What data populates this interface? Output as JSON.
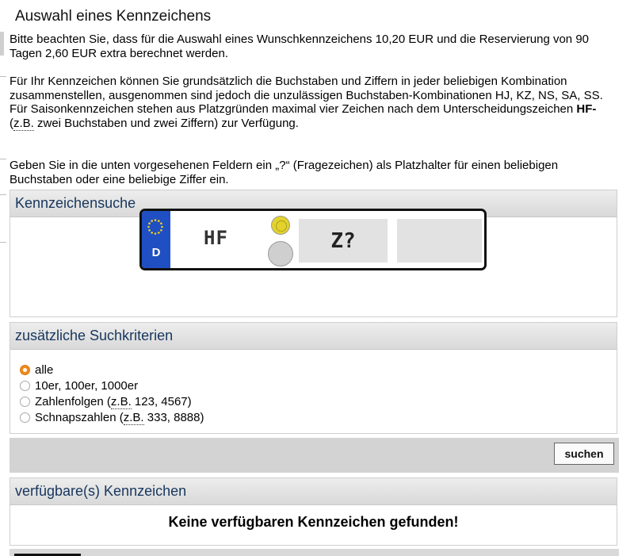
{
  "title": "Auswahl eines Kennzeichens",
  "intro": {
    "fee_text": "Bitte beachten Sie, dass für die Auswahl eines Wunschkennzeichens 10,20 EUR und die Reservierung von 90 Tagen 2,60 EUR extra berechnet werden.",
    "combo_text": "Für Ihr Kennzeichen können Sie grundsätzlich die Buchstaben und Ziffern in jeder beliebigen Kombination zusammenstellen, ausgenommen sind jedoch die unzulässigen Buchstaben-Kombinationen HJ, KZ, NS, SA, SS.",
    "season_pre": "Für Saisonkennzeichen stehen aus Platzgründen maximal vier Zeichen nach dem Unterscheidungszeichen ",
    "season_bold": "HF-",
    "season_abbr": "z.B.",
    "season_post": " zwei Buchstaben und zwei Ziffern) zur Verfügung.",
    "season_paren": "(",
    "wildcard_text": "Geben Sie in die unten vorgesehenen Feldern ein „?“ (Fragezeichen) als Platzhalter für einen beliebigen Buchstaben oder eine beliebige Ziffer ein."
  },
  "search_panel": {
    "heading": "Kennzeichensuche",
    "plate": {
      "country": "D",
      "city_code": "HF",
      "letters_value": "Z?",
      "numbers_value": ""
    }
  },
  "criteria_panel": {
    "heading": "zusätzliche Suchkriterien",
    "options": [
      {
        "label": "alle",
        "checked": true
      },
      {
        "label": "10er, 100er, 1000er",
        "checked": false
      },
      {
        "pre": "Zahlenfolgen (",
        "abbr": "z.B.",
        "post": " 123, 4567)",
        "checked": false
      },
      {
        "pre": "Schnapszahlen (",
        "abbr": "z.B.",
        "post": " 333, 8888)",
        "checked": false
      }
    ]
  },
  "actions": {
    "search_label": "suchen"
  },
  "results_panel": {
    "heading": "verfügbare(s) Kennzeichen",
    "empty_message": "Keine verfügbaren Kennzeichen gefunden!"
  },
  "colors": {
    "heading_text": "#17365d",
    "radio_checked": "#f08a1c",
    "eu_band": "#1f4fc2"
  },
  "icons": [
    "eu-stars-icon",
    "registration-seal-icon",
    "inspection-seal-icon"
  ]
}
